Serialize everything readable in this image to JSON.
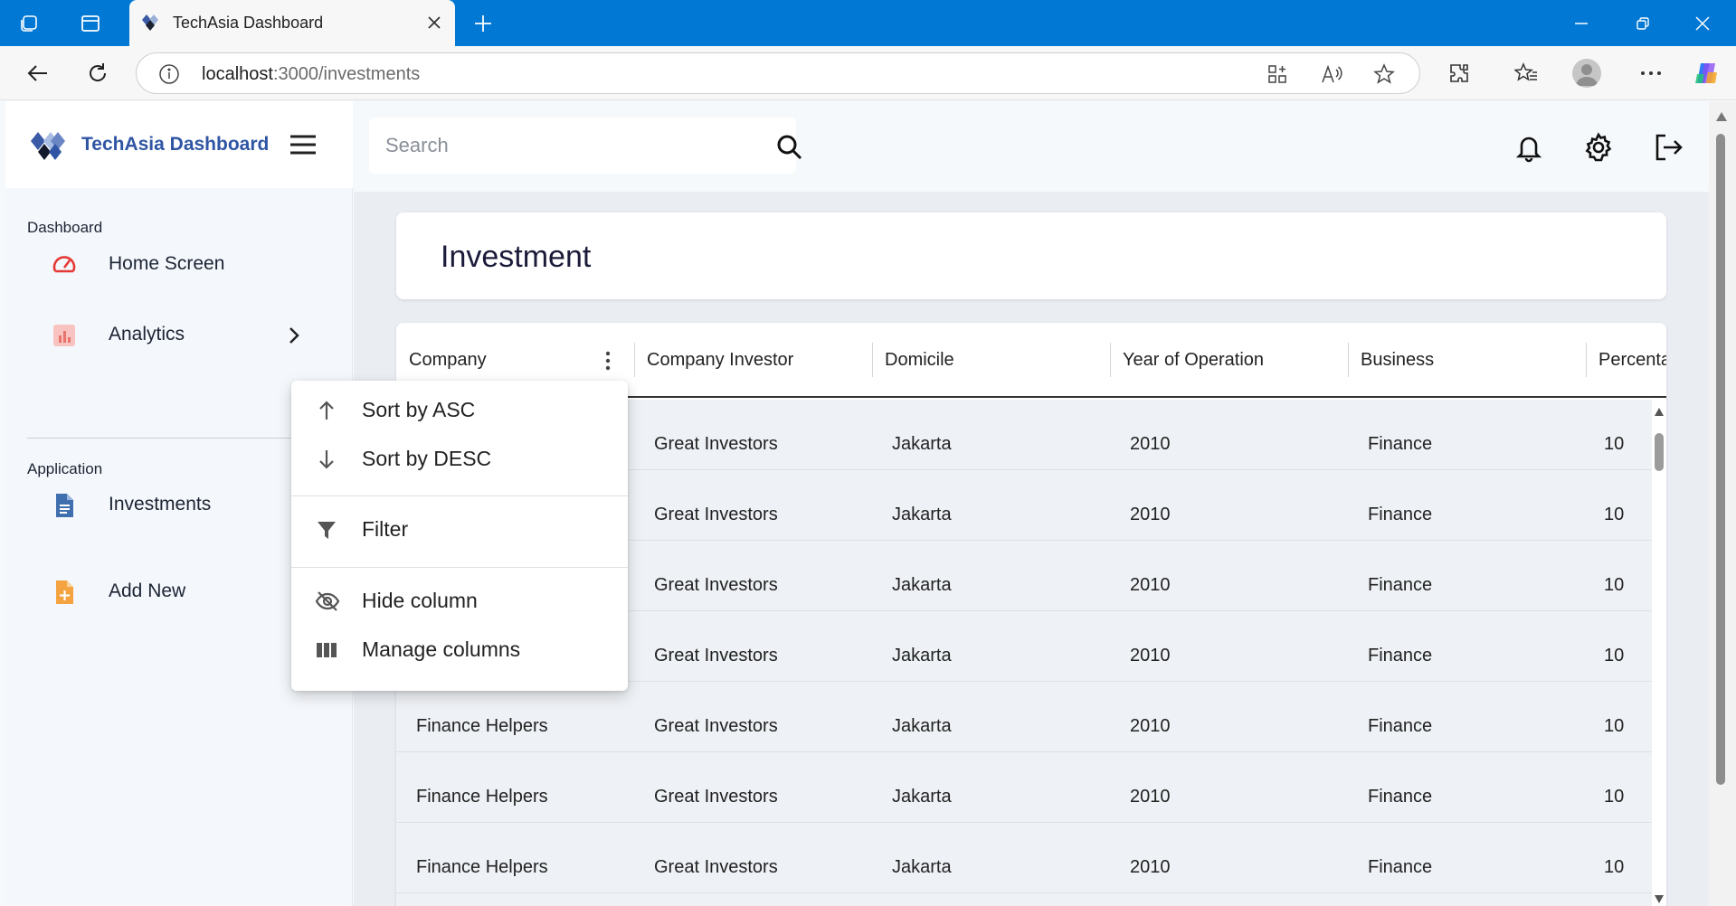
{
  "browser": {
    "tab_title": "TechAsia Dashboard",
    "url_host": "localhost",
    "url_rest": ":3000/investments",
    "accent": "#0078d4"
  },
  "app": {
    "brand": "TechAsia Dashboard",
    "search_placeholder": "Search",
    "sidebar": {
      "section_dashboard": "Dashboard",
      "section_application": "Application",
      "items": [
        {
          "label": "Home Screen",
          "icon": "speedometer-icon",
          "color": "#e53935"
        },
        {
          "label": "Analytics",
          "icon": "chart-icon",
          "color": "#f28b82"
        },
        {
          "label": "Investments",
          "icon": "document-icon",
          "color": "#3f6fae"
        },
        {
          "label": "Add New",
          "icon": "add-file-icon",
          "color": "#f4a340"
        }
      ]
    },
    "page_title": "Investment",
    "columns": [
      "Company",
      "Company Investor",
      "Domicile",
      "Year of Operation",
      "Business",
      "Percenta"
    ],
    "rows": [
      {
        "company": "",
        "investor": "Great Investors",
        "domicile": "Jakarta",
        "year": "2010",
        "business": "Finance",
        "percent": "10"
      },
      {
        "company": "",
        "investor": "Great Investors",
        "domicile": "Jakarta",
        "year": "2010",
        "business": "Finance",
        "percent": "10"
      },
      {
        "company": "",
        "investor": "Great Investors",
        "domicile": "Jakarta",
        "year": "2010",
        "business": "Finance",
        "percent": "10"
      },
      {
        "company": "",
        "investor": "Great Investors",
        "domicile": "Jakarta",
        "year": "2010",
        "business": "Finance",
        "percent": "10"
      },
      {
        "company": "Finance Helpers",
        "investor": "Great Investors",
        "domicile": "Jakarta",
        "year": "2010",
        "business": "Finance",
        "percent": "10"
      },
      {
        "company": "Finance Helpers",
        "investor": "Great Investors",
        "domicile": "Jakarta",
        "year": "2010",
        "business": "Finance",
        "percent": "10"
      },
      {
        "company": "Finance Helpers",
        "investor": "Great Investors",
        "domicile": "Jakarta",
        "year": "2010",
        "business": "Finance",
        "percent": "10"
      }
    ],
    "column_menu": {
      "sort_asc": "Sort by ASC",
      "sort_desc": "Sort by DESC",
      "filter": "Filter",
      "hide_column": "Hide column",
      "manage_columns": "Manage columns"
    }
  }
}
